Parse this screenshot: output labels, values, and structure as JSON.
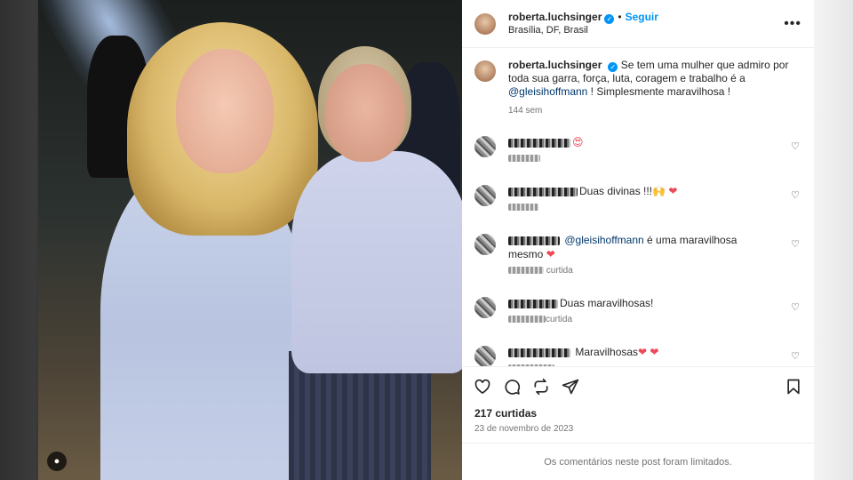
{
  "post": {
    "username": "roberta.luchsinger",
    "follow_label": "Seguir",
    "separator": "•",
    "location": "Brasília, DF, Brasil",
    "more_label": "•••",
    "verified_mark": "✓"
  },
  "caption": {
    "username": "roberta.luchsinger",
    "text_before": "Se tem uma mulher que admiro por toda sua garra, força, luta, coragem e trabalho é a ",
    "mention": "@gleisihoffmann",
    "text_after": " ! Simplesmente maravilhosa !",
    "time": "144 sem"
  },
  "comments": [
    {
      "text": "",
      "emoji": "😍",
      "sub": "",
      "heart": "♡"
    },
    {
      "text": "Duas divinas !!!",
      "emoji": "🙌",
      "emoji2": "❤",
      "sub": "",
      "heart": "♡"
    },
    {
      "mention": "@gleisihoffmann",
      "text": " é uma maravilhosa mesmo",
      "emoji2": "❤",
      "sub": "curtida",
      "heart": "♡"
    },
    {
      "text": "Duas maravilhosas!",
      "sub": "curtida",
      "heart": "♡"
    },
    {
      "text": "Maravilhosas",
      "emoji2": "❤ ❤",
      "sub": "",
      "heart": "♡"
    }
  ],
  "actions": {
    "likes": "217 curtidas",
    "date": "23 de novembro de 2023"
  },
  "footer": {
    "limited": "Os comentários neste post foram limitados."
  },
  "photo": {
    "user_tag_icon": "●"
  }
}
